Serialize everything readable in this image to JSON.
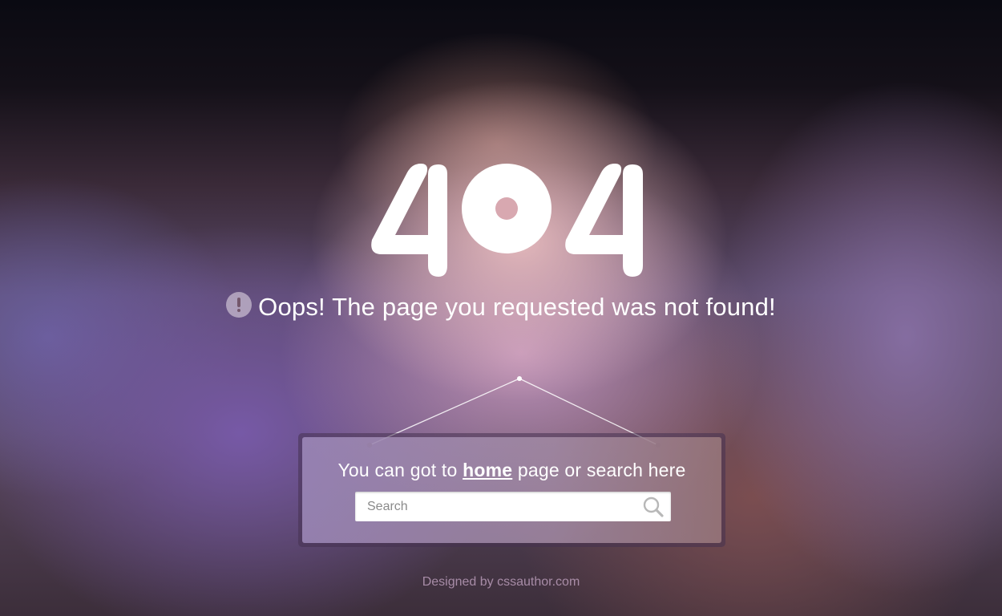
{
  "hero": {
    "code": "404"
  },
  "message": {
    "icon": "exclamation-icon",
    "text": "Oops! The page you requested was not found!"
  },
  "sign": {
    "prefix": "You can got to ",
    "link_label": "home",
    "suffix": " page or search here",
    "search": {
      "placeholder": "Search",
      "value": "",
      "icon": "search-icon"
    }
  },
  "footer": {
    "credit": "Designed by cssauthor.com"
  },
  "colors": {
    "text": "#ffffff",
    "footer_text": "#c8aac8",
    "search_bg": "#ffffff"
  }
}
